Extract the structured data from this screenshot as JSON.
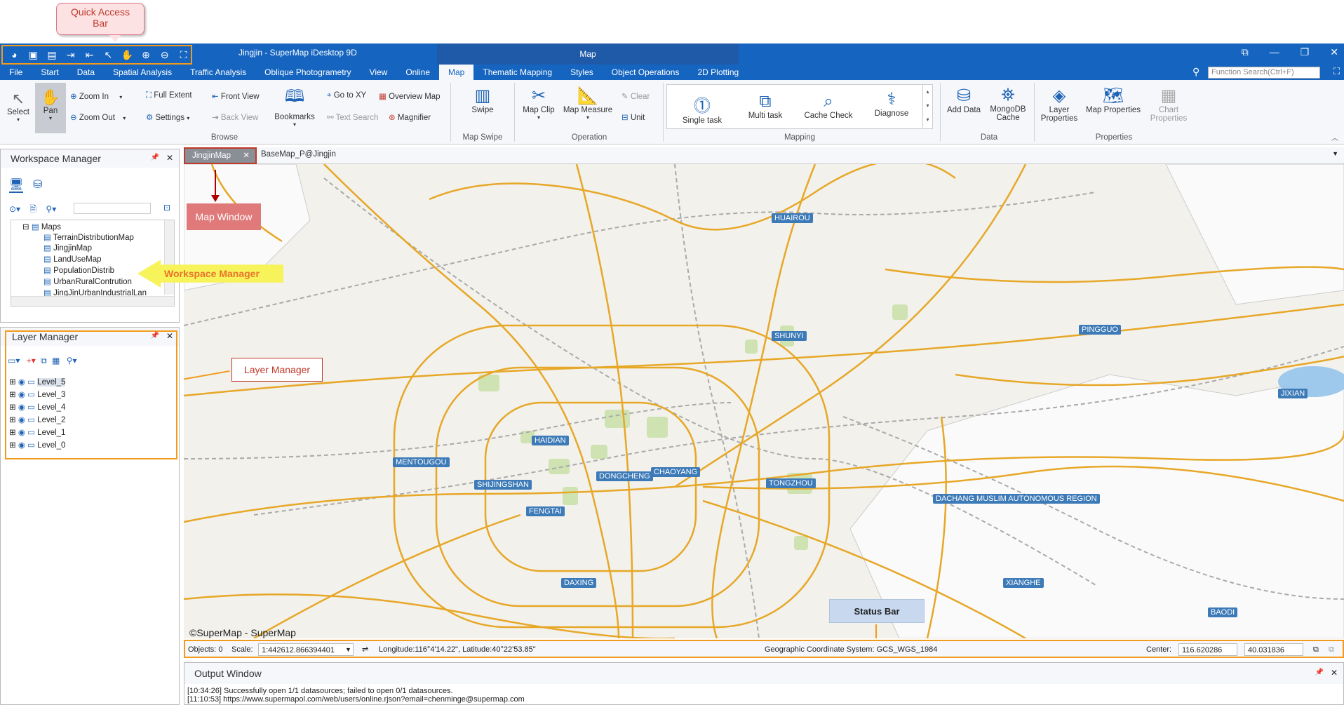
{
  "app": {
    "window_title": "Jingjin - SuperMap iDesktop 9D",
    "context_tab": "Map",
    "function_search_placeholder": "Function Search(Ctrl+F)"
  },
  "menu": [
    "File",
    "Start",
    "Data",
    "Spatial Analysis",
    "Traffic Analysis",
    "Oblique Photogrametry",
    "View",
    "Online",
    "Map",
    "Thematic Mapping",
    "Styles",
    "Object Operations",
    "2D Plotting"
  ],
  "menu_active": "Map",
  "ribbon": {
    "select": "Select",
    "pan": "Pan",
    "zoom_in": "Zoom In",
    "zoom_out": "Zoom Out",
    "full_extent": "Full Extent",
    "settings": "Settings",
    "front_view": "Front View",
    "back_view": "Back View",
    "bookmarks": "Bookmarks",
    "go_to_xy": "Go to XY",
    "text_search": "Text Search",
    "overview_map": "Overview Map",
    "magnifier": "Magnifier",
    "swipe": "Swipe",
    "map_clip": "Map Clip",
    "map_measure": "Map Measure",
    "clear": "Clear",
    "unit": "Unit",
    "single_task": "Single task",
    "multi_task": "Multi task",
    "cache_check": "Cache Check",
    "diagnose": "Diagnose",
    "add_data": "Add Data",
    "mongodb_cache_1": "MongoDB",
    "mongodb_cache_2": "Cache",
    "layer_properties_1": "Layer",
    "layer_properties_2": "Properties",
    "map_properties": "Map Properties",
    "chart_properties_1": "Chart",
    "chart_properties_2": "Properties",
    "groups": {
      "browse": "Browse",
      "map_swipe": "Map Swipe",
      "operation": "Operation",
      "mapping": "Mapping",
      "data": "Data",
      "properties": "Properties"
    }
  },
  "workspace": {
    "title": "Workspace Manager",
    "root": "Maps",
    "maps": [
      "TerrainDistributionMap",
      "JingjinMap",
      "LandUseMap",
      "PopulationDistrib",
      "UrbanRuralContrution",
      "JingJinUrbanIndustrialLan"
    ]
  },
  "layers": {
    "title": "Layer Manager",
    "items": [
      "Level_5",
      "Level_3",
      "Level_4",
      "Level_2",
      "Level_1",
      "Level_0"
    ]
  },
  "tabs": {
    "active": "JingjinMap",
    "other": "BaseMap_P@Jingjin"
  },
  "map": {
    "cities": [
      "HUAIROU",
      "SHUNYI",
      "PINGGUO",
      "JIXIAN",
      "HAIDIAN",
      "MENTOUGOU",
      "DONGCHENG",
      "CHAOYANG",
      "SHIJINGSHAN",
      "TONGZHOU",
      "FENGTAI",
      "DAXING",
      "XIANGHE",
      "BAODI",
      "DACHANG MUSLIM AUTONOMOUS REGION"
    ],
    "copyright": "©SuperMap - SuperMap"
  },
  "callouts": {
    "quick_access": "Quick Access Bar",
    "map_window": "Map Window",
    "workspace_manager": "Workspace Manager",
    "layer_manager": "Layer Manager",
    "status_bar": "Status Bar"
  },
  "status": {
    "objects": "Objects: 0",
    "scale_label": "Scale:",
    "scale_value": "1:442612.866394401",
    "coords": "Longitude:116°4'14.22\", Latitude:40°22'53.85\"",
    "crs": "Geographic Coordinate System: GCS_WGS_1984",
    "center_label": "Center:",
    "center_x": "116.620286",
    "center_y": "40.031836"
  },
  "output": {
    "title": "Output Window",
    "line1": "[10:34:26] Successfully open 1/1 datasources; failed to open 0/1 datasources.",
    "line2": "[11:10:53] https://www.supermapol.com/web/users/online.rjson?email=chenminge@supermap.com"
  }
}
